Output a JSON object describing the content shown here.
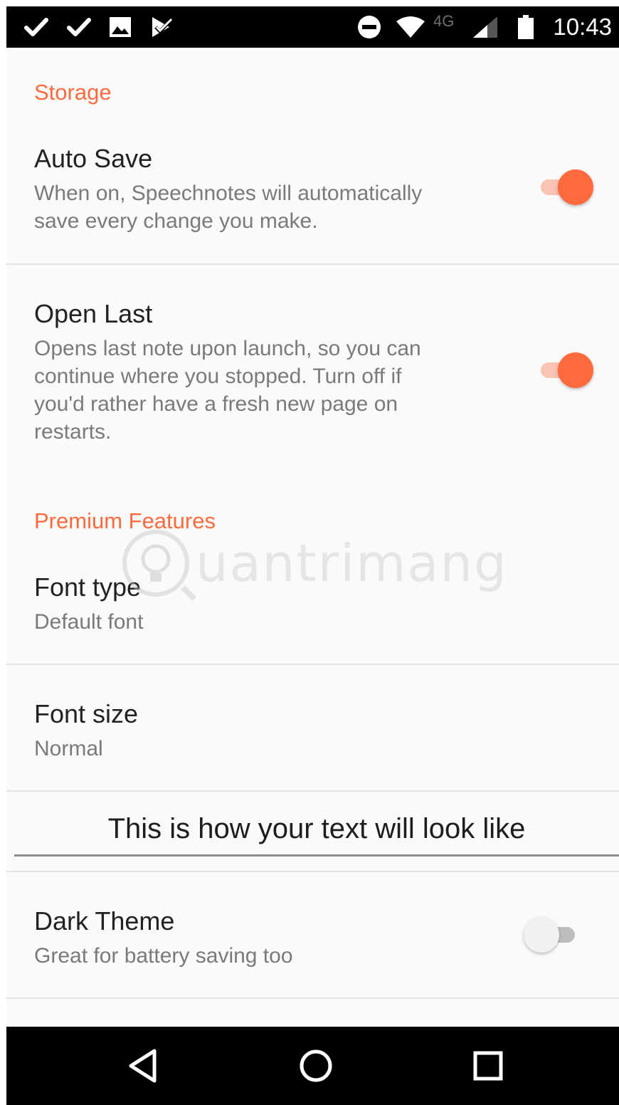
{
  "status_bar": {
    "time": "10:43",
    "network_type": "4G",
    "icons": [
      "check-icon",
      "check-icon",
      "image-icon",
      "checkbox-icon",
      "do-not-disturb-icon",
      "wifi-icon",
      "signal-icon",
      "battery-icon"
    ]
  },
  "sections": {
    "storage": {
      "header": "Storage",
      "auto_save": {
        "title": "Auto Save",
        "summary_line1": "When on, Speechnotes will automatically",
        "summary_line2": "save every change you make.",
        "enabled": true
      },
      "open_last": {
        "title": "Open Last",
        "summary_line1": "Opens last note upon launch, so you can",
        "summary_line2": "continue where you stopped. Turn off if",
        "summary_line3": "you'd rather have a fresh new page on",
        "summary_line4": "restarts.",
        "enabled": true
      }
    },
    "premium": {
      "header": "Premium Features",
      "font_type": {
        "title": "Font type",
        "summary": "Default font"
      },
      "font_size": {
        "title": "Font size",
        "summary": "Normal"
      },
      "preview_text": "This is how your text will look like",
      "dark_theme": {
        "title": "Dark Theme",
        "summary": "Great for battery saving too",
        "enabled": false
      }
    }
  },
  "watermark": "uantrimang",
  "nav_bar": {
    "icons": [
      "back-icon",
      "home-icon",
      "recents-icon"
    ]
  },
  "colors": {
    "accent": "#ff6a3d",
    "accent_track": "#f9c4b3",
    "background": "#fafafa",
    "title_text": "#222222",
    "summary_text": "#7a7a7a"
  }
}
